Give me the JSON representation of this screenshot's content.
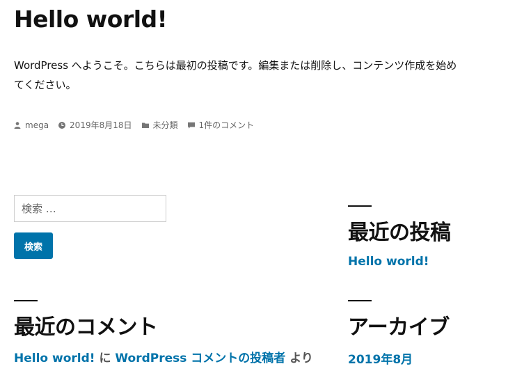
{
  "post": {
    "title": "Hello world!",
    "content": "WordPress へようこそ。こちらは最初の投稿です。編集または削除し、コンテンツ作成を始めてください。",
    "meta": {
      "author": "mega",
      "date": "2019年8月18日",
      "category": "未分類",
      "comments": "1件のコメント"
    }
  },
  "search": {
    "placeholder": "検索 …",
    "button_label": "検索"
  },
  "widgets": {
    "recent_posts": {
      "title": "最近の投稿",
      "items": [
        "Hello world!"
      ]
    },
    "recent_comments": {
      "title": "最近のコメント",
      "item": {
        "post_link": "Hello world!",
        "joiner": "に",
        "author_link": "WordPress コメントの投稿者",
        "suffix": "より"
      }
    },
    "archives": {
      "title": "アーカイブ",
      "items": [
        "2019年8月"
      ]
    }
  },
  "colors": {
    "link": "#0073aa",
    "button_bg": "#0073aa",
    "text": "#111111",
    "meta_text": "#666666"
  }
}
